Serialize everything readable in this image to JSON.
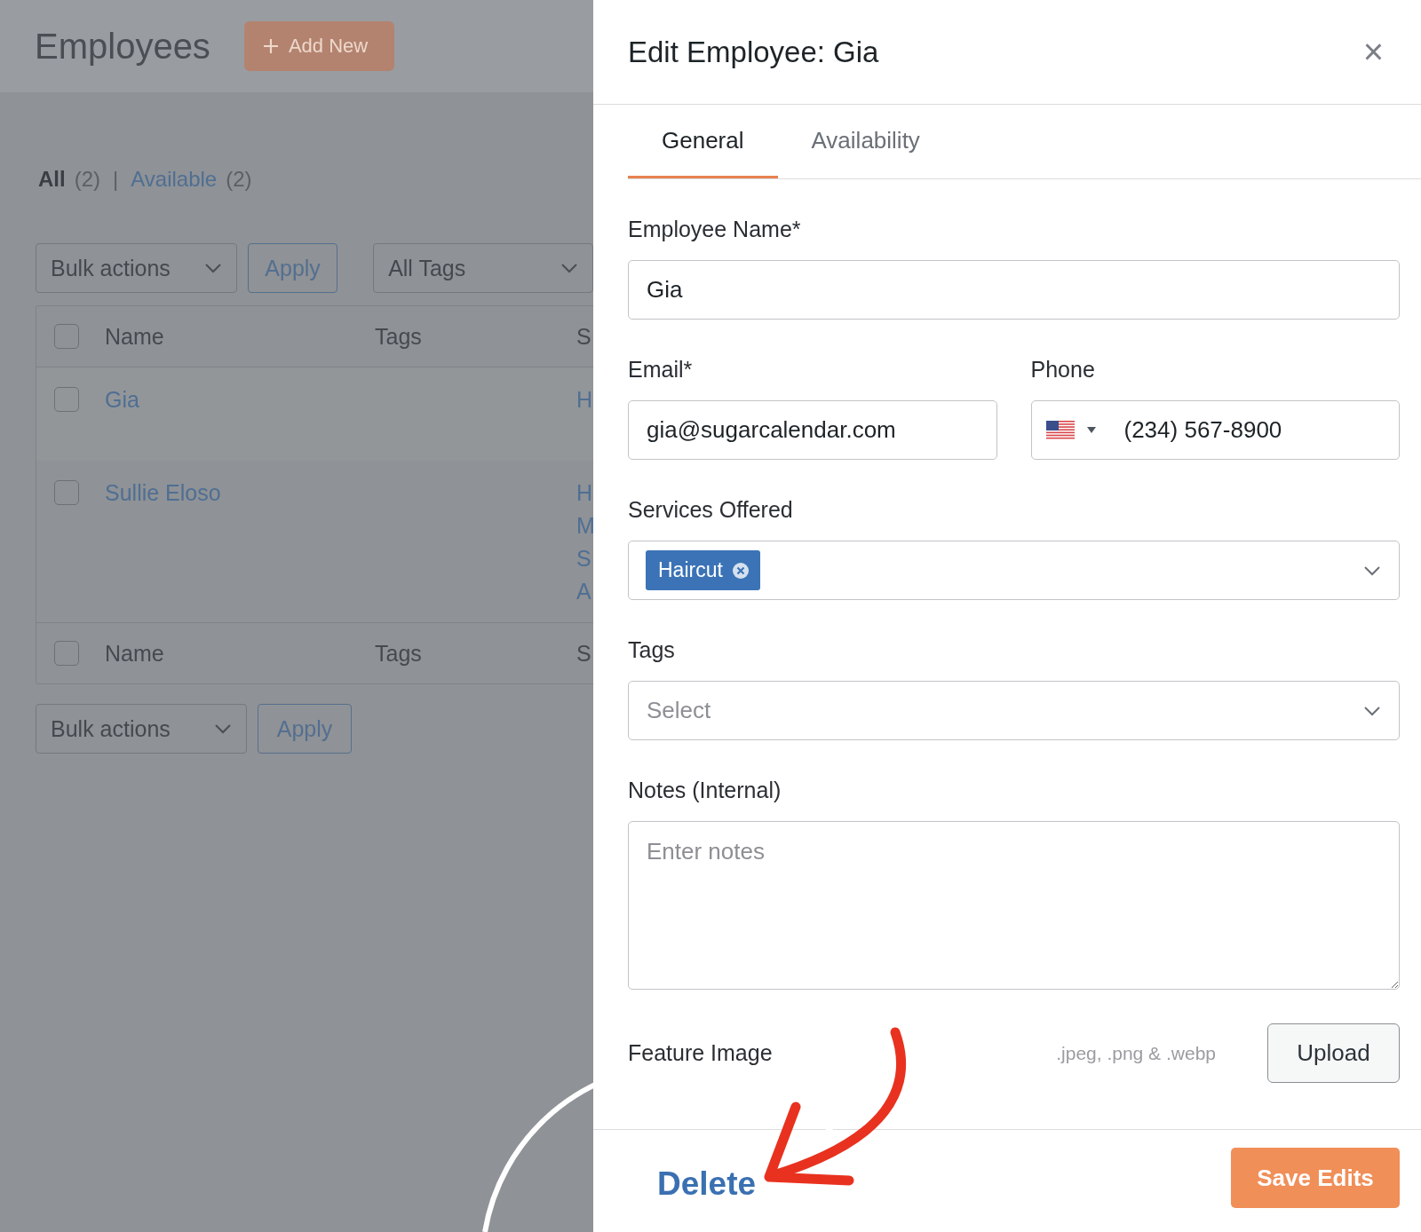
{
  "background": {
    "page_title": "Employees",
    "add_button": "Add New",
    "filters": [
      {
        "label": "All",
        "count": "(2)",
        "selected": true
      },
      {
        "label": "Available",
        "count": "(2)",
        "selected": false
      }
    ],
    "filter_separator": "|",
    "bulk_actions": "Bulk actions",
    "apply": "Apply",
    "tags_filter": "All Tags",
    "table": {
      "header_checked": false,
      "columns": [
        "Name",
        "Tags",
        "S"
      ],
      "rows": [
        {
          "name": "Gia",
          "checked": false,
          "services": [
            "H"
          ]
        },
        {
          "name": "Sullie Eloso",
          "checked": false,
          "services": [
            "H",
            "M",
            "S",
            "A"
          ]
        }
      ],
      "footer_checked": false,
      "footer_columns": [
        "Name",
        "Tags",
        "S"
      ]
    },
    "bottom_bulk_actions": "Bulk actions",
    "bottom_apply": "Apply"
  },
  "panel": {
    "title": "Edit Employee: Gia",
    "close": "×",
    "tabs": [
      {
        "label": "General",
        "selected": true
      },
      {
        "label": "Availability",
        "selected": false
      }
    ],
    "employee_name": {
      "label": "Employee Name*",
      "value": "Gia"
    },
    "email": {
      "label": "Email*",
      "value": "gia@sugarcalendar.com"
    },
    "phone": {
      "label": "Phone",
      "value": "(234) 567-8900"
    },
    "services": {
      "label": "Services Offered",
      "chips": [
        "Haircut"
      ]
    },
    "tags": {
      "label": "Tags",
      "placeholder": "Select"
    },
    "notes": {
      "label": "Notes (Internal)",
      "placeholder": "Enter notes"
    },
    "feature_image": {
      "label": "Feature Image",
      "hint": ".jpeg, .png & .webp",
      "button": "Upload"
    },
    "footer": {
      "delete": "Delete",
      "save": "Save Edits"
    }
  }
}
